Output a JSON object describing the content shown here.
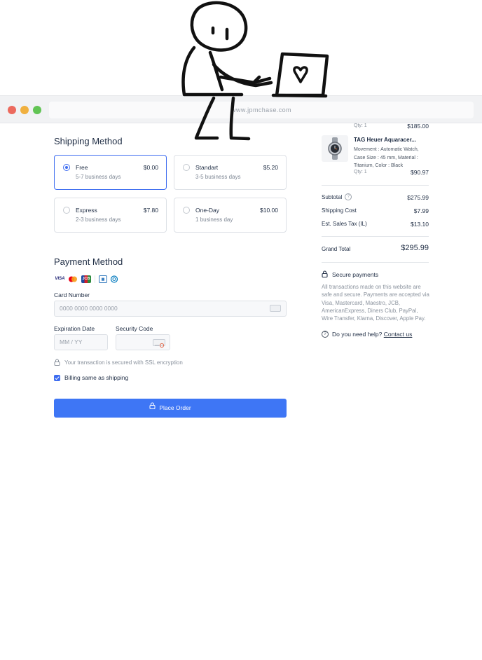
{
  "browser": {
    "url": "www.jpmchase.com"
  },
  "shipping": {
    "title": "Shipping Method",
    "options": [
      {
        "name": "Free",
        "price": "$0.00",
        "days": "5-7 business days",
        "selected": true
      },
      {
        "name": "Standart",
        "price": "$5.20",
        "days": "3-5 business days",
        "selected": false
      },
      {
        "name": "Express",
        "price": "$7.80",
        "days": "2-3 business days",
        "selected": false
      },
      {
        "name": "One-Day",
        "price": "$10.00",
        "days": "1 business day",
        "selected": false
      }
    ]
  },
  "payment": {
    "title": "Payment Method",
    "brands": [
      "VISA",
      "mastercard-icon",
      "JCB",
      "amex-icon",
      "diners-icon"
    ],
    "card_number_label": "Card Number",
    "card_number_placeholder": "0000 0000 0000 0000",
    "expiration_label": "Expiration Date",
    "expiration_placeholder": "MM / YY",
    "security_label": "Security Code",
    "ssl_text": "Your transaction is secured with SSL encryption",
    "billing_label": "Billing same as shipping",
    "billing_checked": true,
    "place_order": "Place Order"
  },
  "summary": {
    "prev_item": {
      "qty": "Qty: 1",
      "price": "$185.00"
    },
    "item": {
      "title": "TAG Heuer Aquaracer...",
      "description": "Movement : Automatic Watch, Case Size : 45 mm, Material : Titanium, Color : Black",
      "qty": "Qty: 1",
      "price": "$90.97"
    },
    "subtotal_label": "Subtotal",
    "subtotal": "$275.99",
    "shipping_label": "Shipping Cost",
    "shipping": "$7.99",
    "tax_label": "Est. Sales Tax (IL)",
    "tax": "$13.10",
    "grand_total_label": "Grand Total",
    "grand_total": "$295.99",
    "secure_title": "Secure payments",
    "secure_body": "All transactions made on this website are safe and secure. Payments are accepted via Visa, Mastercard, Maestro, JCB, AmericanExpress, Diners Club, PayPal, Wire Transfer, Klarna, Discover, Apple Pay.",
    "help_text": "Do you need help?",
    "help_link": "Contact us"
  },
  "colors": {
    "accent": "#3e76f5",
    "text": "#1f2d44",
    "muted": "#8a929d"
  }
}
